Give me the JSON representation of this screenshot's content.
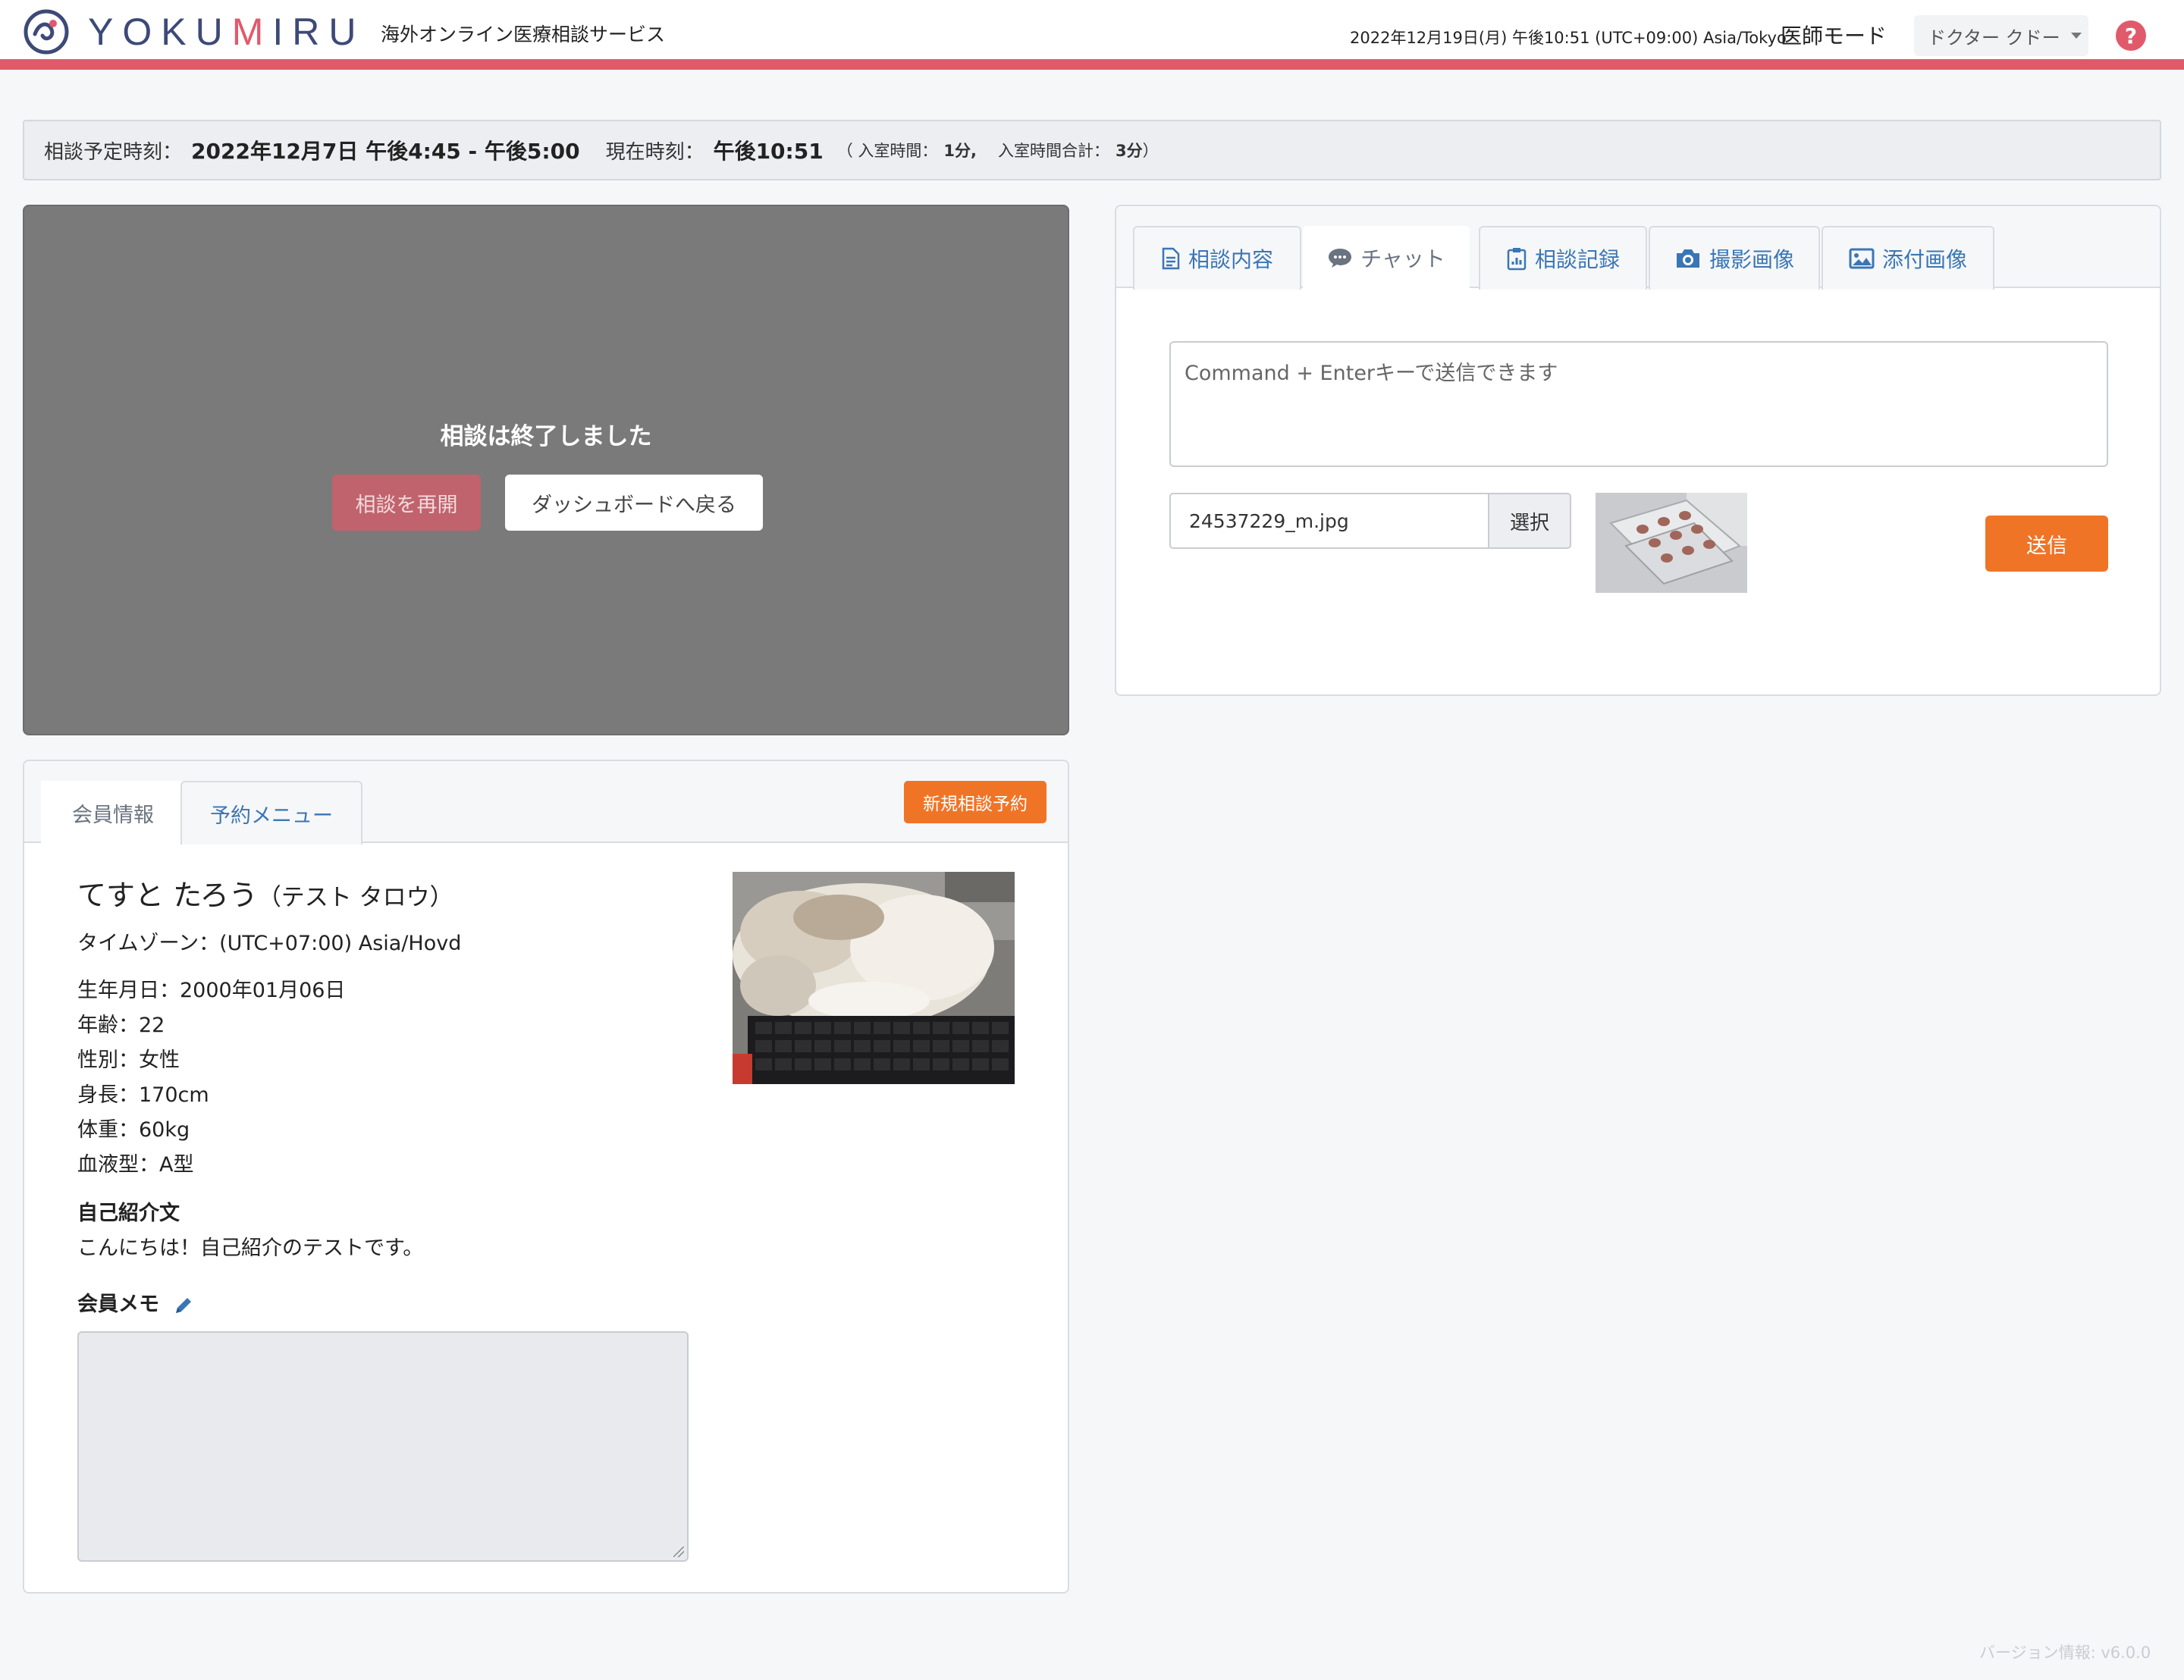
{
  "header": {
    "logo_text_1": "YOKU",
    "logo_text_m": "M",
    "logo_text_2": "IRU",
    "tagline": "海外オンライン医療相談サービス",
    "datetime": "2022年12月19日(月) 午後10:51 (UTC+09:00) Asia/Tokyo",
    "mode": "医師モード",
    "user": "ドクター クドー",
    "help": "?"
  },
  "status": {
    "scheduled_label": "相談予定時刻：",
    "scheduled_value": "2022年12月7日 午後4:45 - 午後5:00",
    "current_label": "現在時刻：",
    "current_value": "午後10:51",
    "room_time_label": "（ 入室時間：",
    "room_time_value": "1分,",
    "room_total_label": "入室時間合計：",
    "room_total_value": "3分",
    "close_paren": "）"
  },
  "video": {
    "ended_message": "相談は終了しました",
    "resume_label": "相談を再開",
    "dashboard_label": "ダッシュボードへ戻る"
  },
  "member": {
    "tabs": [
      {
        "label": "会員情報",
        "active": true
      },
      {
        "label": "予約メニュー",
        "active": false
      }
    ],
    "new_booking_label": "新規相談予約",
    "name": "てすと たろう",
    "name_kana": "（テスト タロウ）",
    "timezone": "タイムゾーン：(UTC+07:00) Asia/Hovd",
    "birthdate": "生年月日：2000年01月06日",
    "age": "年齢：22",
    "gender": "性別：女性",
    "height": "身長：170cm",
    "weight": "体重：60kg",
    "blood": "血液型：A型",
    "intro_heading": "自己紹介文",
    "intro_text": "こんにちは！自己紹介のテストです。",
    "memo_heading": "会員メモ",
    "memo_value": ""
  },
  "right": {
    "tabs": [
      {
        "label": "相談内容",
        "icon": "document-icon",
        "active": false
      },
      {
        "label": "チャット",
        "icon": "chat-bubble-icon",
        "active": true
      },
      {
        "label": "相談記録",
        "icon": "clipboard-icon",
        "active": false
      },
      {
        "label": "撮影画像",
        "icon": "camera-icon",
        "active": false
      },
      {
        "label": "添付画像",
        "icon": "image-icon",
        "active": false
      }
    ],
    "chat_placeholder": "Command + Enterキーで送信できます",
    "file_name": "24537229_m.jpg",
    "select_label": "選択",
    "send_label": "送信"
  },
  "footer": {
    "version": "バージョン情報: v6.0.0"
  },
  "colors": {
    "accent_red": "#e05a6b",
    "accent_orange": "#f07426",
    "link_blue": "#3a76b5",
    "brand_navy": "#3d4a78"
  }
}
